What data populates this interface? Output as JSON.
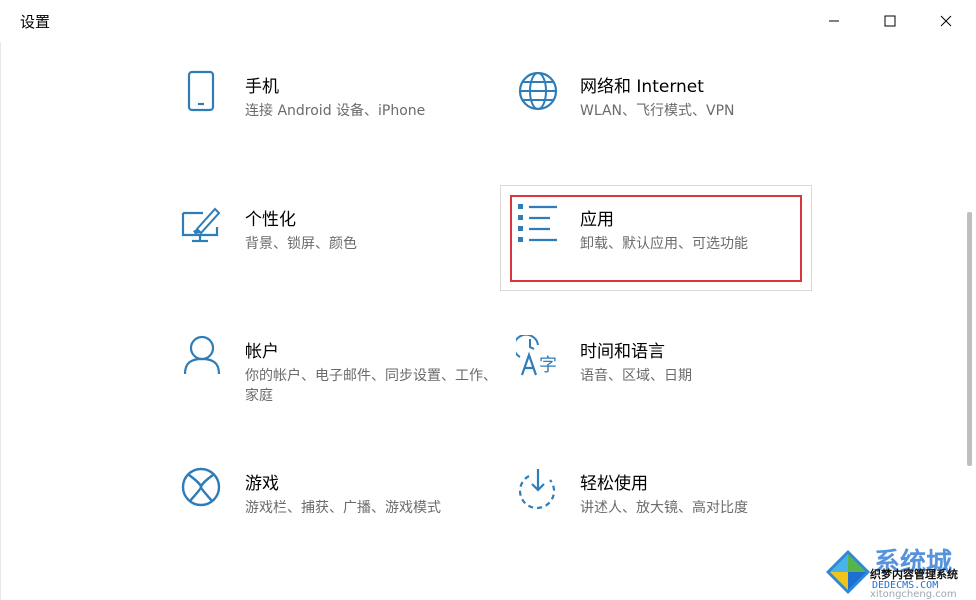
{
  "window": {
    "title": "设置",
    "minimize_icon": "minimize-icon",
    "maximize_icon": "maximize-icon",
    "close_icon": "close-icon"
  },
  "colors": {
    "icon_blue": "#2e7cb8",
    "highlight_red": "#d9363e",
    "desc_gray": "#6b6b6b"
  },
  "tiles": [
    {
      "title": "手机",
      "desc": "连接 Android 设备、iPhone",
      "icon": "phone-icon"
    },
    {
      "title": "网络和 Internet",
      "desc": "WLAN、飞行模式、VPN",
      "icon": "globe-icon"
    },
    {
      "title": "个性化",
      "desc": "背景、锁屏、颜色",
      "icon": "personalization-icon"
    },
    {
      "title": "应用",
      "desc": "卸载、默认应用、可选功能",
      "icon": "apps-list-icon"
    },
    {
      "title": "帐户",
      "desc": "你的帐户、电子邮件、同步设置、工作、家庭",
      "icon": "person-icon"
    },
    {
      "title": "时间和语言",
      "desc": "语音、区域、日期",
      "icon": "time-language-icon"
    },
    {
      "title": "游戏",
      "desc": "游戏栏、捕获、广播、游戏模式",
      "icon": "xbox-icon"
    },
    {
      "title": "轻松使用",
      "desc": "讲述人、放大镜、高对比度",
      "icon": "ease-of-access-icon"
    }
  ],
  "watermark": {
    "brand": "系统城",
    "subtitle": "织梦内容管理系统",
    "url": "DEDECMS.COM",
    "url2": "xitongcheng.com"
  }
}
